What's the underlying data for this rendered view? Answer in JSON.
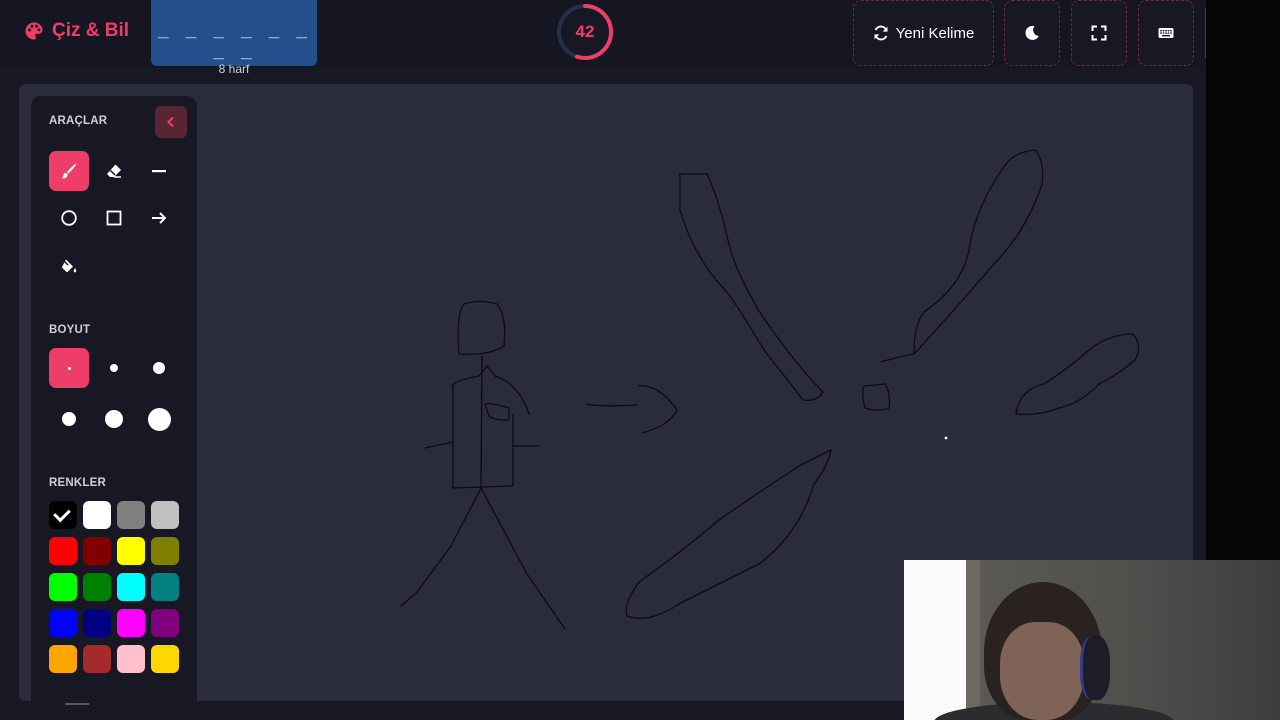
{
  "app": {
    "name": "Çiz & Bil"
  },
  "word": {
    "blanks": "_ _ _ _ _ _ _ _",
    "length_label": "8 harf"
  },
  "timer": {
    "value": "42",
    "remaining_fraction": 0.55
  },
  "toolbar": {
    "new_word_label": "Yeni Kelime",
    "theme_icon": "moon-icon",
    "fullscreen_icon": "expand-icon",
    "keyboard_icon": "keyboard-icon"
  },
  "panel": {
    "tools_title": "ARAÇLAR",
    "size_title": "BOYUT",
    "colors_title": "RENKLER",
    "tools": [
      "brush",
      "eraser",
      "line",
      "circle",
      "rectangle",
      "arrow",
      "fill"
    ],
    "active_tool": "brush",
    "sizes": [
      2,
      4,
      6,
      8,
      10,
      12
    ],
    "active_size": 2,
    "colors": [
      "#000000",
      "#ffffff",
      "#808080",
      "#c0c0c0",
      "#ff0000",
      "#800000",
      "#ffff00",
      "#808000",
      "#00ff00",
      "#008000",
      "#00ffff",
      "#008080",
      "#0000ff",
      "#000080",
      "#ff00ff",
      "#800080",
      "#ffa500",
      "#a52a2a",
      "#ffc0cb",
      "#ffd700"
    ],
    "selected_color": "#000000"
  },
  "theme": {
    "accent": "#ee3d68",
    "canvas": "#2b2c3b",
    "word_box": "#23508c"
  }
}
